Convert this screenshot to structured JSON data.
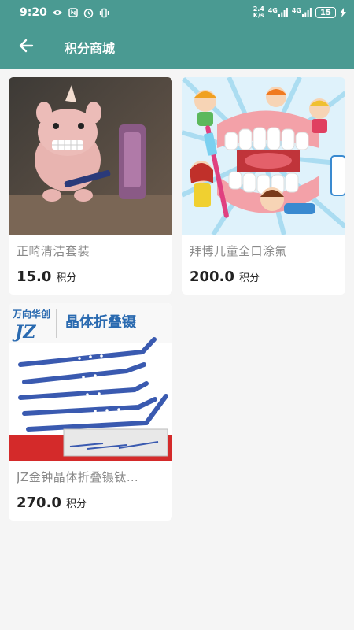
{
  "status_bar": {
    "time": "9:20",
    "net_speed": "2.4\nK/s",
    "signal1": "4G",
    "signal2": "4G",
    "battery": "15"
  },
  "app_bar": {
    "title": "积分商城",
    "back_icon": "arrow-left-icon"
  },
  "products": [
    {
      "name": "正畸清洁套装",
      "price": "15.0",
      "unit": "积分",
      "image": "pink-plush-toy-with-toothbrush"
    },
    {
      "name": "拜博儿童全口涂氟",
      "price": "200.0",
      "unit": "积分",
      "image": "cartoon-kids-with-teeth"
    },
    {
      "name": "JZ金钟晶体折叠镊钛…",
      "price": "270.0",
      "unit": "积分",
      "image": "titanium-forceps"
    }
  ],
  "product_image_text": {
    "brand_cn": "万向华创",
    "brand_logo": "JZ",
    "banner": "晶体折叠镊"
  },
  "colors": {
    "primary": "#4a9a92",
    "background": "#f5f5f5",
    "card": "#ffffff",
    "name_text": "#8a8a8a",
    "price_text": "#222222"
  }
}
